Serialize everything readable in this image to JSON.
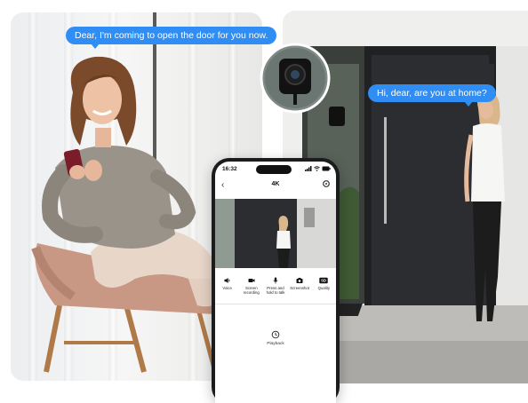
{
  "bubbles": {
    "woman": "Dear, I'm coming to open the door for you now.",
    "visitor": "Hi, dear, are you at home?"
  },
  "phone": {
    "time": "16:32",
    "title": "4K",
    "controls": [
      {
        "icon": "speaker-icon",
        "label": "Voice"
      },
      {
        "icon": "video-camera-icon",
        "label": "Screen recording"
      },
      {
        "icon": "microphone-icon",
        "label": "Press and hold to talk"
      },
      {
        "icon": "camera-icon",
        "label": "Screenshot"
      },
      {
        "icon": "sd-badge-icon",
        "label": "Quality",
        "badge": "SD"
      }
    ],
    "playback_label": "Playback"
  },
  "colors": {
    "bubble": "#2f8df3",
    "door": "#2b2d30",
    "sweater": "#9a938a"
  }
}
